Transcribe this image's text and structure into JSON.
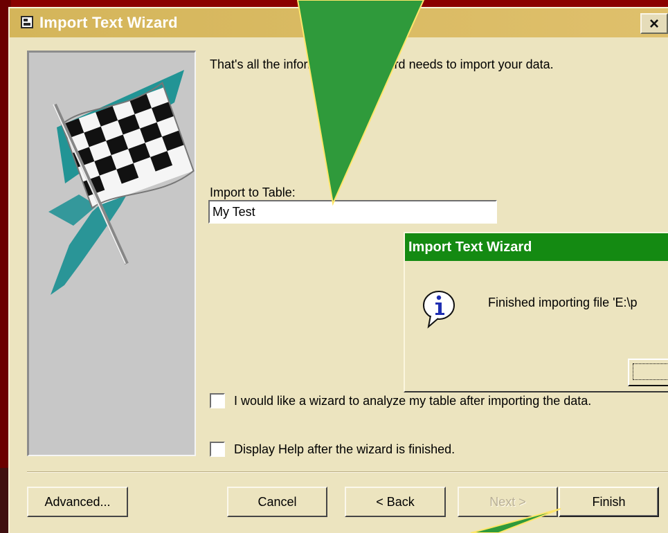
{
  "window": {
    "title": "Import Text Wizard",
    "close_label": "×"
  },
  "wizard": {
    "intro": "That's all the information the wizard needs to import your data.",
    "import_label": "Import to Table:",
    "table_name": "My Test",
    "analyze_checkbox_label": "I would like a wizard to analyze my table after importing the data.",
    "help_checkbox_label": "Display Help after the wizard is finished.",
    "analyze_checked": false,
    "help_checked": false
  },
  "buttons": {
    "advanced": "Advanced...",
    "cancel": "Cancel",
    "back": "< Back",
    "next": "Next >",
    "finish": "Finish"
  },
  "message": {
    "title": "Import Text Wizard",
    "text": "Finished importing file 'E:\\p"
  },
  "icons": {
    "window_icon": "window-icon",
    "info_icon": "information-icon",
    "illustration": "checkered-flag-icon"
  },
  "colors": {
    "dialog_bg": "#ece4bf",
    "titlebar": "#d4b55a",
    "message_titlebar": "#148a12",
    "annotation_arrow": "#2f9a3b",
    "background": "#8b0000"
  }
}
